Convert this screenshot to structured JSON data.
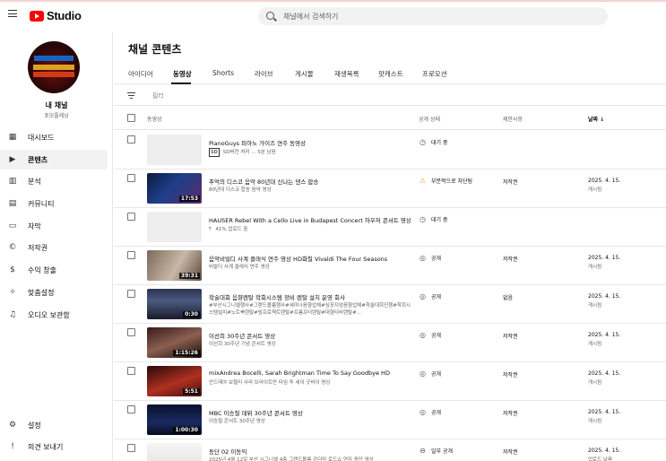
{
  "app": {
    "logo_text": "Studio",
    "search_placeholder": "채널에서 검색하기"
  },
  "channel": {
    "name": "내 채널",
    "sub": "포모플레닝"
  },
  "sidebar": {
    "items": [
      {
        "label": "대시보드",
        "icon": "dashboard-icon"
      },
      {
        "label": "콘텐츠",
        "icon": "content-icon",
        "active": true
      },
      {
        "label": "분석",
        "icon": "analytics-icon"
      },
      {
        "label": "커뮤니티",
        "icon": "community-icon"
      },
      {
        "label": "자막",
        "icon": "subtitles-icon"
      },
      {
        "label": "저작권",
        "icon": "copyright-icon"
      },
      {
        "label": "수익 창출",
        "icon": "dollar-icon"
      },
      {
        "label": "맞춤설정",
        "icon": "magic-wand-icon"
      },
      {
        "label": "오디오 보관함",
        "icon": "audio-library-icon"
      }
    ],
    "bottom": [
      {
        "label": "설정",
        "icon": "gear-icon"
      },
      {
        "label": "의견 보내기",
        "icon": "feedback-icon"
      }
    ]
  },
  "main": {
    "title": "채널 콘텐츠",
    "tabs": [
      "아이디어",
      "동영상",
      "Shorts",
      "라이브",
      "게시물",
      "재생목록",
      "팟캐스트",
      "프로모션"
    ],
    "filter_label": "필터",
    "columns": {
      "video": "동영상",
      "visibility": "공개 상태",
      "restrictions": "제한사항",
      "date": "날짜"
    }
  },
  "rows": [
    {
      "title": "PianoGuys 피아노 가이즈 연주 동영상",
      "desc": "SD버전 처리 ... 5분 남음",
      "sd_badge": "SD",
      "status": "대기 중",
      "status_icon": "clock-icon",
      "restrict": "",
      "date": "",
      "date_sub": "",
      "duration": "",
      "thumb": "blank"
    },
    {
      "title": "추억의 디스코 음악 80년대 신나는 댄스 합송",
      "desc": "80년대 디스코 합송 음악 영상",
      "status": "부분적으로 차단됨",
      "status_icon": "warning-icon",
      "restrict": "저작권",
      "date": "2025. 4. 15.",
      "date_sub": "게시됨",
      "duration": "17:53",
      "thumb": "stage-blue"
    },
    {
      "title": "HAUSER Rebel With a Cello Live in Budapest Concert 하우저 콘서트 영상",
      "desc": "41% 업로드 중",
      "status": "대기 중",
      "status_icon": "clock-icon",
      "restrict": "",
      "date": "",
      "date_sub": "",
      "duration": "",
      "thumb": "blank",
      "uploading": true
    },
    {
      "title": "음악비빌디 사계 클래식 연주 영상 HD화질 Vivaldi The Four Seasons",
      "desc": "비발디 사계 클래식 연주 영상",
      "status": "공개",
      "status_icon": "globe-icon",
      "restrict": "저작권",
      "date": "2025. 4. 15.",
      "date_sub": "게시됨",
      "duration": "39:31",
      "thumb": "portrait"
    },
    {
      "title": "학술대회 음향렌탈 학회시스템 장비 렌탈 설치 운영 회사",
      "desc": "#부산시그니엘행사#그랜드볼룸행사#세미나음향업체#심포지엄음향업체#학술대회진행#학회시스템설치#노트북렌탈#빔프로젝트렌탈#프롬프터렌탈#대형티비렌탈#...",
      "status": "공개",
      "status_icon": "globe-icon",
      "restrict": "없음",
      "date": "2025. 4. 15.",
      "date_sub": "게시됨",
      "duration": "0:30",
      "thumb": "conference"
    },
    {
      "title": "이선희 30주년 콘서트 영상",
      "desc": "이선희 30주년 기념 콘서트 영상",
      "status": "공개",
      "status_icon": "globe-icon",
      "restrict": "저작권",
      "date": "2025. 4. 15.",
      "date_sub": "게시됨",
      "duration": "1:15:26",
      "thumb": "singer"
    },
    {
      "title": "mixAndrea Bocelli, Sarah Brightman Time To Say Goodbye HD",
      "desc": "안드레아 보첼리 사라 브라이트만 타임 투 세이 굿바이 영상",
      "status": "공개",
      "status_icon": "globe-icon",
      "restrict": "저작권",
      "date": "2025. 4. 15.",
      "date_sub": "게시됨",
      "duration": "5:51",
      "thumb": "duet"
    },
    {
      "title": "MBC 이승철 데뷔 30주년 콘서트 영상",
      "desc": "이승철 콘서트 30주년 영상",
      "status": "공개",
      "status_icon": "globe-icon",
      "restrict": "저작권",
      "date": "2025. 4. 15.",
      "date_sub": "게시됨",
      "duration": "1:00:30",
      "thumb": "stage-dark"
    },
    {
      "title": "동단 02 이동익",
      "desc": "2025년 4월 12일 부산 시그니엘 4층 그랜드볼룸 강더마 로드쇼 연자 동단 영상",
      "status": "일부 공개",
      "status_icon": "link-icon",
      "restrict": "저작권",
      "date": "2025. 4. 15.",
      "date_sub": "업로드 날짜",
      "duration": "",
      "thumb": "slide"
    }
  ]
}
